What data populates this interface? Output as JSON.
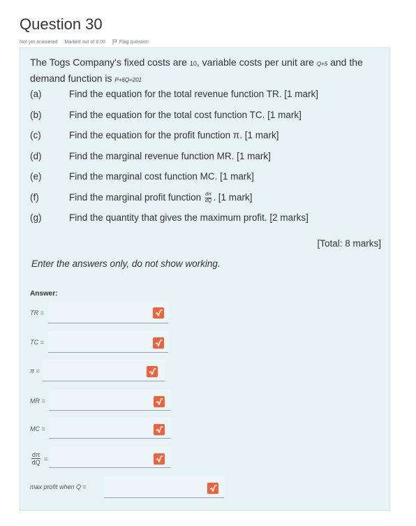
{
  "question": {
    "title": "Question 30",
    "status": "Not yet answered",
    "marked": "Marked out of 8.00",
    "flag_label": "Flag question",
    "flag_icon": "flag-icon"
  },
  "intro": {
    "text1": "The Togs Company's fixed costs are ",
    "fixed": "10",
    "text2": ", variable costs per unit are ",
    "variable": "Q+5",
    "text3": " and the demand function is ",
    "demand": "P+6Q=201"
  },
  "parts": [
    {
      "label": "(a)",
      "text": "Find the equation for the total revenue function TR.  [1 mark]"
    },
    {
      "label": "(b)",
      "text": "Find the equation for the total cost function TC. [1 mark]"
    },
    {
      "label": "(c)",
      "text": "Find the equation for the profit function π. [1 mark]"
    },
    {
      "label": "(d)",
      "text": "Find the marginal revenue function MR. [1 mark]"
    },
    {
      "label": "(e)",
      "text": "Find the marginal cost function MC. [1 mark]"
    },
    {
      "label": "(f)",
      "text_before": "Find the marginal profit function ",
      "frac_num": "dπ",
      "frac_den": "dQ",
      "text_after": ". [1 mark]"
    },
    {
      "label": "(g)",
      "text": "Find the quantity that gives the maximum profit. [2 marks]"
    }
  ],
  "total": "[Total: 8 marks]",
  "instruction": "Enter the answers only, do not show working.",
  "answer_label": "Answer:",
  "answers": [
    {
      "label": "TR =",
      "value": ""
    },
    {
      "label": "TC =",
      "value": ""
    },
    {
      "label": "π =",
      "value": ""
    },
    {
      "label": "MR =",
      "value": ""
    },
    {
      "label": "MC =",
      "value": ""
    },
    {
      "frac_num": "dπ",
      "frac_den": "dQ",
      "label": "=",
      "value": ""
    },
    {
      "label": "max profit when Q =",
      "value": ""
    }
  ],
  "colors": {
    "panel": "#e7f3f5",
    "check": "#f0623b"
  }
}
